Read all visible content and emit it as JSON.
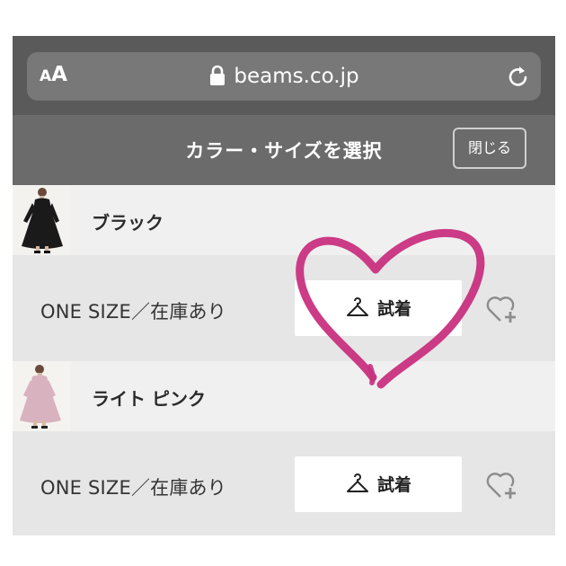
{
  "browser": {
    "text_size_small": "A",
    "text_size_big": "A",
    "url": "beams.co.jp",
    "lock_icon": "lock-icon",
    "reload_icon": "reload-icon"
  },
  "sheet": {
    "title": "カラー・サイズを選択",
    "close_label": "閉じる"
  },
  "colors": [
    {
      "name": "ブラック",
      "size_label": "ONE SIZE／在庫あり",
      "tryon_label": "試着",
      "tryon_icon": "hanger-icon",
      "favorite_icon": "heart-plus-icon"
    },
    {
      "name": "ライト ピンク",
      "size_label": "ONE SIZE／在庫あり",
      "tryon_label": "試着",
      "tryon_icon": "hanger-icon",
      "favorite_icon": "heart-plus-icon"
    }
  ],
  "annotation": {
    "shape": "hand-drawn-heart",
    "color": "#c8307f"
  },
  "theme": {
    "browser_bar": "#5a5a5a",
    "header": "#6b6b6b",
    "row_light": "#f0f0f0",
    "row_dark": "#e6e6e6"
  }
}
